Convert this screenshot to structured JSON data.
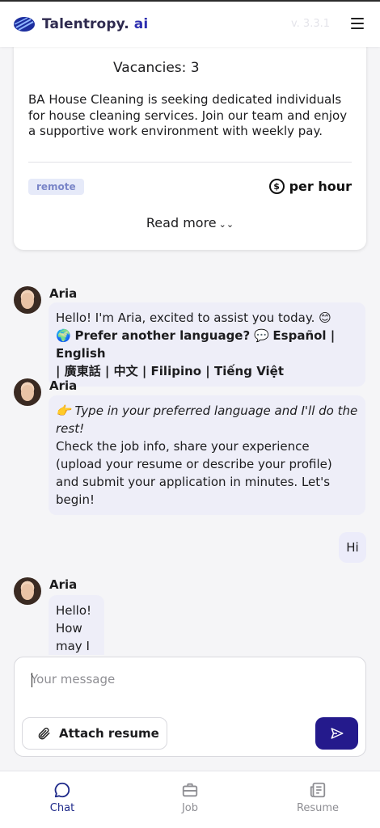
{
  "header": {
    "brand_name": "Talentropy.",
    "brand_ai": " ai",
    "version": "v. 3.3.1",
    "menu_icon": "hamburger-menu-icon"
  },
  "job_card": {
    "vacancies": "Vacancies: 3",
    "description": "BA House Cleaning is seeking dedicated individuals for house cleaning services. Join our team and enjoy a supportive work environment with weekly pay.",
    "badge": "remote",
    "pay_label": "per hour",
    "pay_icon": "dollar-circle-icon",
    "read_more": "Read more",
    "read_more_icon": "double-chevron-down-icon"
  },
  "messages": [
    {
      "sender": "Aria",
      "line1": "Hello! I'm Aria, excited to assist you today. 😊",
      "line2_prefix": "🌍 ",
      "line2_bold": "Prefer another language?",
      "line2_mid": " 💬 ",
      "line2_langs": "Español | English",
      "line3_langs": "| 廣東話 | 中文 | Filipino | Tiếng Việt"
    },
    {
      "sender": "Aria",
      "italic_text": "👉 Type in your preferred language and I'll do the rest!",
      "body": "Check the job info, share your experience (upload your resume or describe your profile) and submit your application in minutes. Let's begin!"
    },
    {
      "sender": "Aria",
      "body": "Hello! How may I assist you today?"
    }
  ],
  "user_message": "Hi",
  "composer": {
    "placeholder": "Your message",
    "value": "",
    "attach_label": "Attach resume",
    "attach_icon": "paperclip-icon",
    "send_icon": "send-icon"
  },
  "nav": {
    "items": [
      {
        "label": "Chat",
        "icon": "chat-bubble-icon",
        "active": true
      },
      {
        "label": "Job",
        "icon": "briefcase-icon",
        "active": false
      },
      {
        "label": "Resume",
        "icon": "newspaper-icon",
        "active": false
      }
    ]
  },
  "colors": {
    "accent": "#241a8c",
    "bubble_bg": "#eeeef8",
    "badge_bg": "#e6eaf9",
    "nav_active": "#1f2a8a"
  }
}
